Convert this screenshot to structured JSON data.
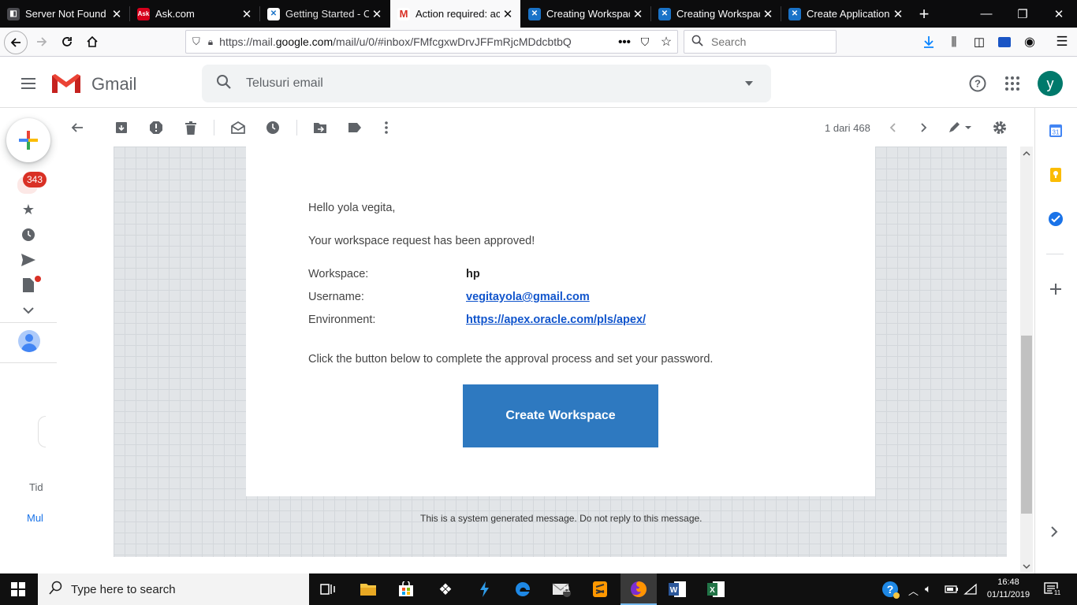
{
  "browser": {
    "tabs": [
      {
        "title": "Server Not Found",
        "icon": "firefox-page-icon"
      },
      {
        "title": "Ask.com",
        "icon": "ask-logo-icon"
      },
      {
        "title": "Getting Started - Or",
        "icon": "oracle-apex-icon"
      },
      {
        "title": "Action required: acc",
        "icon": "gmail-icon",
        "active": true
      },
      {
        "title": "Creating Workspace",
        "icon": "oracle-apex-icon"
      },
      {
        "title": "Creating Workspace",
        "icon": "oracle-apex-icon"
      },
      {
        "title": "Create Application",
        "icon": "oracle-apex-icon"
      }
    ],
    "url_prefix": "https://mail.",
    "url_domain": "google.com",
    "url_rest": "/mail/u/0/#inbox/FMfcgxwDrvJFFmRjcMDdcbtbQ",
    "search_placeholder": "Search"
  },
  "gmail": {
    "logo_text": "Gmail",
    "search_placeholder": "Telusuri email",
    "avatar_letter": "y",
    "inbox_badge": "343",
    "pager": "1 dari 468",
    "rail_cut_1": "Tid",
    "rail_cut_2": "Mul"
  },
  "email": {
    "greeting": "Hello yola vegita,",
    "approved": "Your workspace request has been approved!",
    "workspace_label": "Workspace:",
    "workspace_value": "hp",
    "username_label": "Username:",
    "username_value": "vegitayola@gmail.com",
    "environment_label": "Environment:",
    "environment_value": "https://apex.oracle.com/pls/apex/",
    "instruction": "Click the button below to complete the approval process and set your password.",
    "button_label": "Create Workspace",
    "footer": "This is a system generated message. Do not reply to this message."
  },
  "taskbar": {
    "search_placeholder": "Type here to search",
    "time": "16:48",
    "date": "01/11/2019",
    "notification_count": "11"
  },
  "colors": {
    "brand_button": "#2e79c0",
    "link": "#1155cc",
    "avatar": "#00796b",
    "badge": "#d93025"
  }
}
